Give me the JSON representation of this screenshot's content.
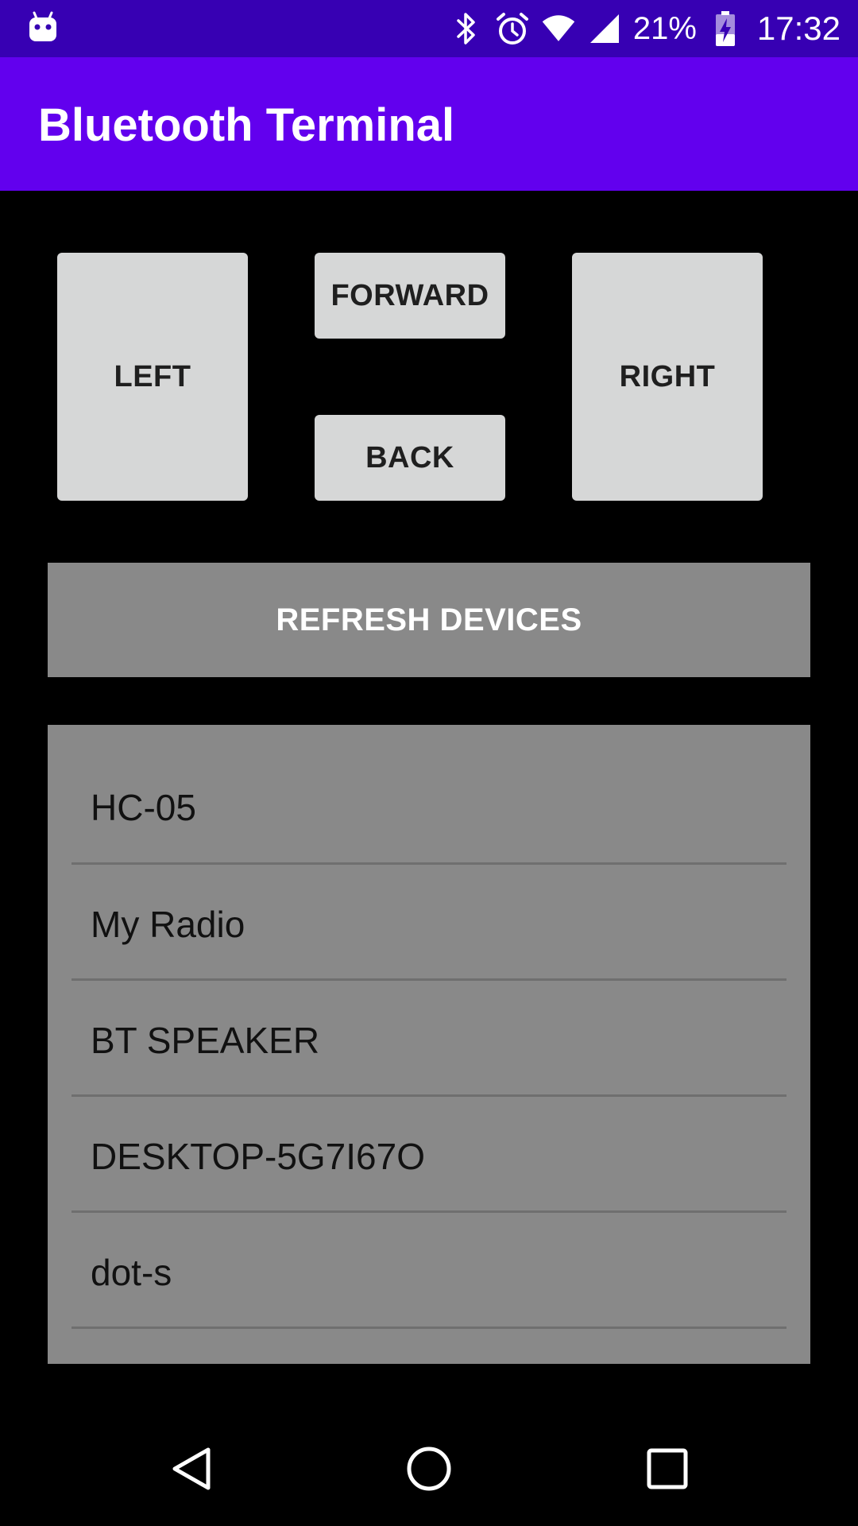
{
  "status_bar": {
    "battery_percent": "21%",
    "time": "17:32",
    "icons": [
      "notification-robot-icon",
      "bluetooth-icon",
      "alarm-icon",
      "wifi-icon",
      "cell-signal-icon",
      "battery-charging-icon"
    ]
  },
  "app_bar": {
    "title": "Bluetooth Terminal"
  },
  "controls": {
    "left_label": "LEFT",
    "forward_label": "FORWARD",
    "back_label": "BACK",
    "right_label": "RIGHT"
  },
  "refresh": {
    "label": "REFRESH DEVICES"
  },
  "devices": [
    {
      "name": "HC-05"
    },
    {
      "name": "My Radio"
    },
    {
      "name": "BT SPEAKER"
    },
    {
      "name": "DESKTOP-5G7I67O"
    },
    {
      "name": "dot-s"
    }
  ],
  "nav_bar": {
    "icons": [
      "back-triangle-icon",
      "home-circle-icon",
      "recents-square-icon"
    ]
  },
  "colors": {
    "status_bar": "#3700b3",
    "app_bar": "#6200ee",
    "control_button": "#d6d7d7",
    "refresh_button": "#898989",
    "device_list": "#898989",
    "background": "#000000"
  }
}
